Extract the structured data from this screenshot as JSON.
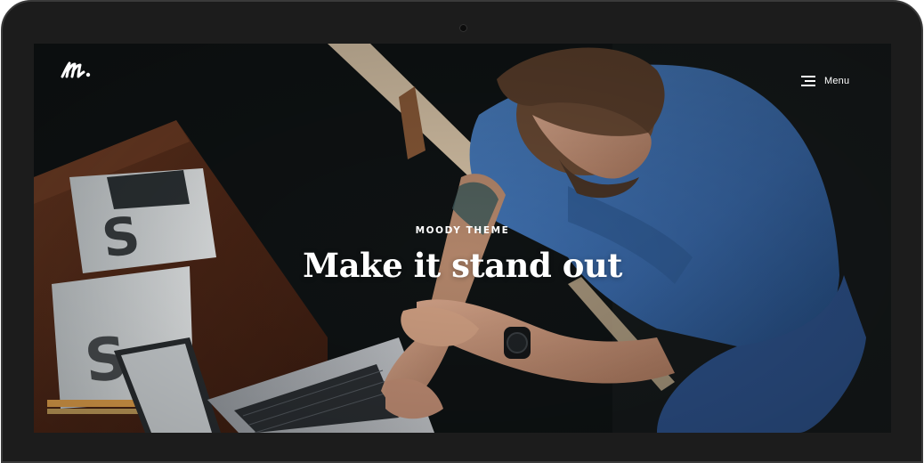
{
  "colors": {
    "bezel": "#1c1c1c",
    "shirt": "#3f6fae",
    "desk": "#5a2e1a",
    "text": "#ffffff"
  },
  "header": {
    "logo_icon": "m-script-logo-icon",
    "menu_icon": "hamburger-menu-icon",
    "menu_label": "Menu"
  },
  "hero": {
    "eyebrow": "MOODY THEME",
    "headline": "Make it stand out"
  }
}
